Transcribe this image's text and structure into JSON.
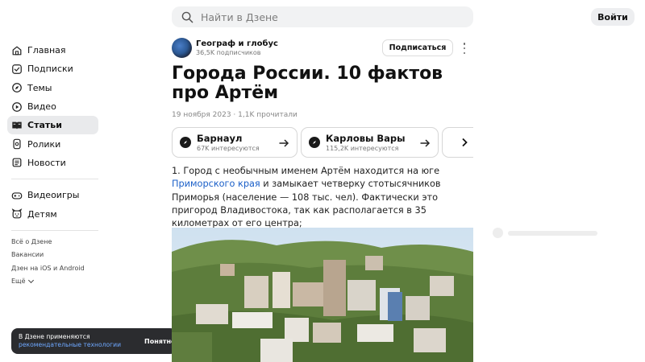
{
  "search": {
    "placeholder": "Найти в Дзене",
    "icon": "search-icon"
  },
  "header": {
    "login_label": "Войти"
  },
  "sidebar": {
    "items": [
      {
        "label": "Главная",
        "icon": "home-icon"
      },
      {
        "label": "Подписки",
        "icon": "subscriptions-icon"
      },
      {
        "label": "Темы",
        "icon": "compass-icon"
      },
      {
        "label": "Видео",
        "icon": "play-icon"
      },
      {
        "label": "Статьи",
        "icon": "book-icon",
        "active": true
      },
      {
        "label": "Ролики",
        "icon": "shorts-icon"
      },
      {
        "label": "Новости",
        "icon": "news-icon"
      }
    ],
    "items2": [
      {
        "label": "Видеоигры",
        "icon": "gamepad-icon"
      },
      {
        "label": "Детям",
        "icon": "kids-icon"
      }
    ],
    "footer": [
      "Всё о Дзене",
      "Вакансии",
      "Дзен на iOS и Android",
      "Ещё"
    ]
  },
  "cookie": {
    "text": "В Дзене применяются",
    "link": "рекомендательные технологии",
    "ok_label": "Понятно"
  },
  "article": {
    "author_name": "Географ и глобус",
    "author_subs": "36,5K подписчиков",
    "subscribe_label": "Подписаться",
    "title": "Города России. 10 фактов про Артём",
    "meta": "19 ноября 2023 · 1,1K прочитали",
    "tags": [
      {
        "name": "Барнаул",
        "sub": "67K интересуются"
      },
      {
        "name": "Карловы Вары",
        "sub": "115,2K интересуются"
      },
      {
        "name": "",
        "sub": ""
      }
    ],
    "body_part1": "1. Город с необычным именем Артём находится на юге ",
    "body_link": "Приморского края",
    "body_part2": " и замыкает четверку стотысячников Приморья (население — 108 тыс. чел). Фактически это пригород Владивостока, так как располагается в 35 километрах от его центра;"
  },
  "colors": {
    "link": "#1a5fc8",
    "active_bg": "#e9eaec",
    "cookie_bg": "#2b2c2f"
  }
}
